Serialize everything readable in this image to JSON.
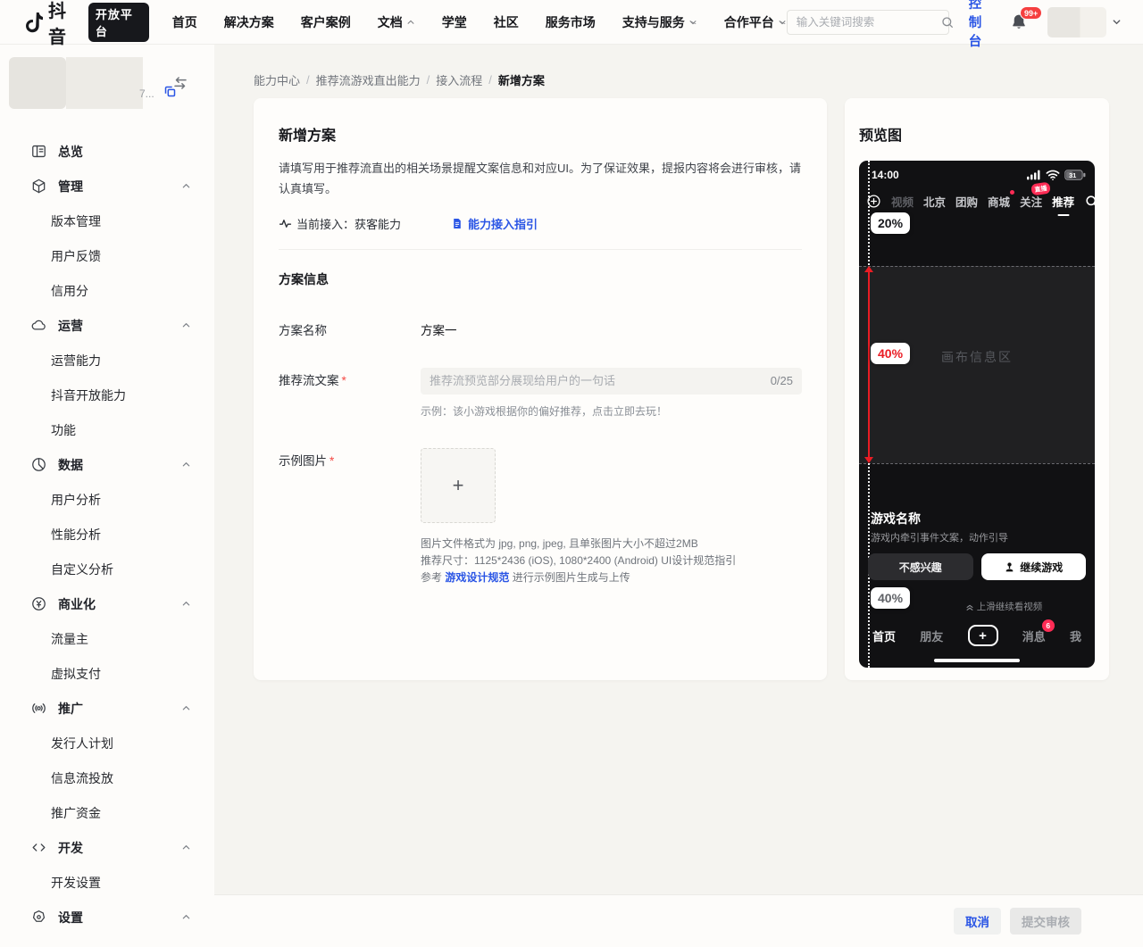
{
  "colors": {
    "accent": "#2a55e5",
    "badge_red": "#f53f3f",
    "douyin_red": "#fe2c55",
    "measure_red": "#ea1c24"
  },
  "topbar": {
    "brand": {
      "name": "抖音",
      "badge": "开放平台"
    },
    "nav": [
      {
        "label": "首页"
      },
      {
        "label": "解决方案"
      },
      {
        "label": "客户案例"
      },
      {
        "label": "文档",
        "caret": "up"
      },
      {
        "label": "学堂"
      },
      {
        "label": "社区"
      },
      {
        "label": "服务市场"
      },
      {
        "label": "支持与服务",
        "caret": "down"
      },
      {
        "label": "合作平台",
        "caret": "down"
      }
    ],
    "search_placeholder": "输入关键词搜索",
    "console_link": "控制台",
    "notification_badge": "99+"
  },
  "sidebar": {
    "app_id_text": "7...",
    "items": [
      {
        "label": "总览",
        "icon": "overview"
      },
      {
        "label": "管理",
        "icon": "manage",
        "expandable": true,
        "children": [
          "版本管理",
          "用户反馈",
          "信用分"
        ]
      },
      {
        "label": "运营",
        "icon": "operation",
        "expandable": true,
        "children": [
          "运营能力",
          "抖音开放能力",
          "功能"
        ]
      },
      {
        "label": "数据",
        "icon": "data",
        "expandable": true,
        "children": [
          "用户分析",
          "性能分析",
          "自定义分析"
        ]
      },
      {
        "label": "商业化",
        "icon": "commercial",
        "expandable": true,
        "children": [
          "流量主",
          "虚拟支付"
        ]
      },
      {
        "label": "推广",
        "icon": "promotion",
        "expandable": true,
        "children": [
          "发行人计划",
          "信息流投放",
          "推广资金"
        ]
      },
      {
        "label": "开发",
        "icon": "develop",
        "expandable": true,
        "children": [
          "开发设置"
        ]
      },
      {
        "label": "设置",
        "icon": "settings",
        "expandable": true,
        "children": []
      }
    ]
  },
  "breadcrumb": [
    "能力中心",
    "推荐流游戏直出能力",
    "接入流程",
    "新增方案"
  ],
  "form": {
    "title": "新增方案",
    "description": "请填写用于推荐流直出的相关场景提醒文案信息和对应UI。为了保证效果，提报内容将会进行审核，请认真填写。",
    "access_label": "当前接入：获客能力",
    "guide_link": "能力接入指引",
    "section_title": "方案信息",
    "plan_name": {
      "label": "方案名称",
      "value": "方案一"
    },
    "feed_copy": {
      "label": "推荐流文案",
      "placeholder": "推荐流预览部分展现给用户的一句话",
      "counter": "0/25",
      "hint": "示例：该小游戏根据你的偏好推荐，点击立即去玩！"
    },
    "example_image": {
      "label": "示例图片",
      "hints": [
        "图片文件格式为 jpg, png, jpeg, 且单张图片大小不超过2MB",
        "推荐尺寸：1125*2436 (iOS), 1080*2400 (Android) UI设计规范指引"
      ],
      "ref_prefix": "参考 ",
      "ref_link": "游戏设计规范",
      "ref_suffix": " 进行示例图片生成与上传"
    }
  },
  "preview": {
    "title": "预览图",
    "phone": {
      "time": "14:00",
      "battery": "31",
      "top_tabs": [
        {
          "label": "视频",
          "dim": true
        },
        {
          "label": "北京"
        },
        {
          "label": "团购"
        },
        {
          "label": "商城",
          "dot": true
        },
        {
          "label": "关注",
          "badge": "直播"
        },
        {
          "label": "推荐",
          "active": true
        }
      ],
      "top_percent": "20%",
      "mid_percent": "40%",
      "bottom_percent": "40%",
      "canvas_label": "画布信息区",
      "game_name": "游戏名称",
      "game_desc": "游戏内牵引事件文案，动作引导",
      "dislike_button": "不感兴趣",
      "continue_button": "继续游戏",
      "swipe_hint": "上滑继续看视频",
      "bottom_tabs": [
        {
          "label": "首页",
          "active": true
        },
        {
          "label": "朋友"
        },
        {
          "type": "plus"
        },
        {
          "label": "消息",
          "badge": "6"
        },
        {
          "label": "我"
        }
      ]
    }
  },
  "footer": {
    "cancel": "取消",
    "submit": "提交审核"
  }
}
